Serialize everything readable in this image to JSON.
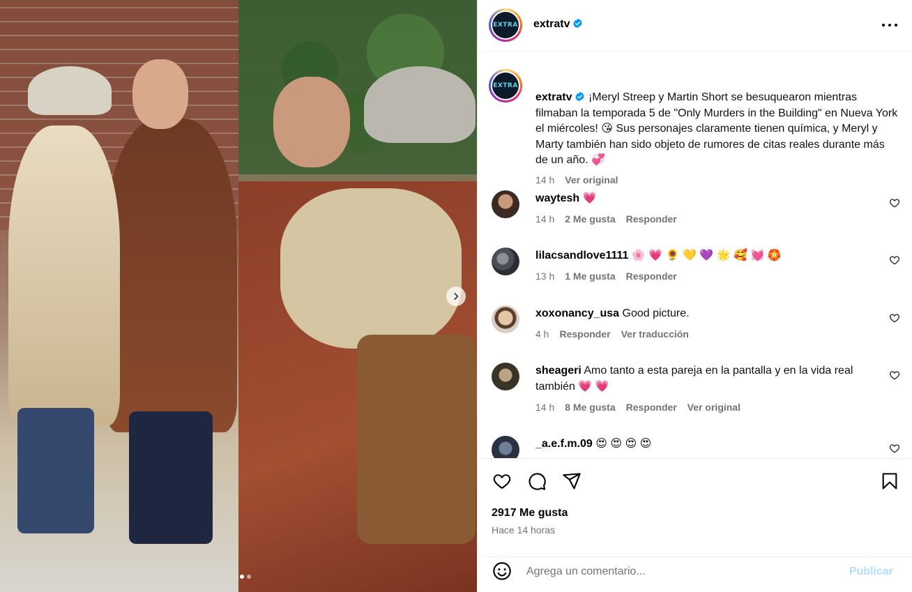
{
  "post": {
    "username": "extratv",
    "avatar_text": "EXTRA",
    "caption": "¡Meryl Streep y Martin Short se besuquearon mientras filmaban la temporada 5 de \"Only Murders in the Building\" en Nueva York el miércoles! 😘 Sus personajes claramente tienen química, y Meryl y Marty también han sido objeto de rumores de citas reales durante más de un año. 💞",
    "caption_time": "14 h",
    "caption_see_original": "Ver original",
    "likes": "2917 Me gusta",
    "posted_ago": "Hace 14 horas"
  },
  "comments": [
    {
      "username": "waytesh",
      "text": "💗",
      "time": "14 h",
      "likes": "2 Me gusta",
      "reply": "Responder",
      "extra": ""
    },
    {
      "username": "lilacsandlove1111",
      "text": "🌸 💗 🌻 💛 💜 🌟 🥰 💓 🏵️",
      "time": "13 h",
      "likes": "1 Me gusta",
      "reply": "Responder",
      "extra": ""
    },
    {
      "username": "xoxonancy_usa",
      "text": "Good picture.",
      "time": "4 h",
      "likes": "",
      "reply": "Responder",
      "extra": "Ver traducción"
    },
    {
      "username": "sheageri",
      "text": "Amo tanto a esta pareja en la pantalla y en la vida real también 💗 💗",
      "time": "14 h",
      "likes": "8 Me gusta",
      "reply": "Responder",
      "extra": "Ver original"
    },
    {
      "username": "_a.e.f.m.09",
      "text": "😍 😍 😍 😍",
      "time": "",
      "likes": "",
      "reply": "",
      "extra": ""
    }
  ],
  "composer": {
    "placeholder": "Agrega un comentario...",
    "publish_label": "Publicar"
  },
  "carousel": {
    "count": 2,
    "active_index": 0
  },
  "colors": {
    "verified": "#0095f6",
    "heart": "#ed4956",
    "publish": "#b2dffc",
    "muted_text": "#737373"
  },
  "icons": [
    "verified-badge-icon",
    "more-options-icon",
    "heart-icon",
    "comment-icon",
    "share-icon",
    "bookmark-icon",
    "emoji-icon",
    "chevron-right-icon"
  ]
}
